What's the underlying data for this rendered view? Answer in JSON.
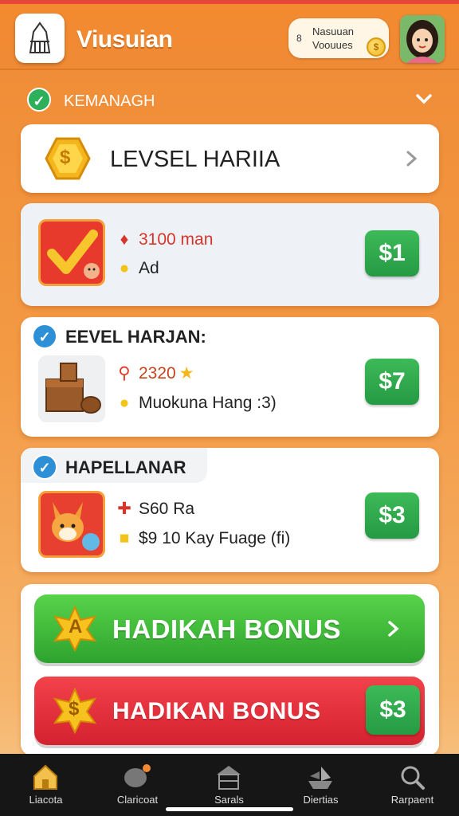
{
  "header": {
    "title": "Viusuian",
    "balance_line1": "Nasuuan",
    "balance_line2": "Voouues",
    "balance_lock": "8",
    "coin_symbol": "$"
  },
  "section": {
    "label": "KEMANAGH"
  },
  "level_card": {
    "coin_symbol": "$",
    "title": "LEVSEL HARIIA"
  },
  "offers": [
    {
      "title": "",
      "stat1": "3100 man",
      "stat2": "Ad",
      "price": "$1"
    },
    {
      "title": "EEVEL HARJAN:",
      "stat1": "2320",
      "stat2": "Muokuna Hang :3)",
      "price": "$7"
    },
    {
      "title": "HAPELLANAR",
      "stat1": "S60 Ra",
      "stat2": "$9 10 Kay Fuage (fi)",
      "price": "$3"
    }
  ],
  "bonus": {
    "green_label": "HADIKAH BONUS",
    "green_star_letter": "A",
    "red_label": "HADIKAN BONUS",
    "red_star_letter": "$",
    "red_price": "$3"
  },
  "tabs": [
    {
      "label": "Liacota",
      "icon": "home-icon"
    },
    {
      "label": "Claricoat",
      "icon": "chat-icon"
    },
    {
      "label": "Sarals",
      "icon": "store-icon"
    },
    {
      "label": "Diertias",
      "icon": "boat-icon"
    },
    {
      "label": "Rarpaent",
      "icon": "search-icon"
    }
  ],
  "colors": {
    "accent_orange": "#f08a34",
    "price_green": "#2eaf4e",
    "bonus_green": "#3fbe3a",
    "bonus_red": "#e52d38",
    "tabbar": "#161616"
  }
}
